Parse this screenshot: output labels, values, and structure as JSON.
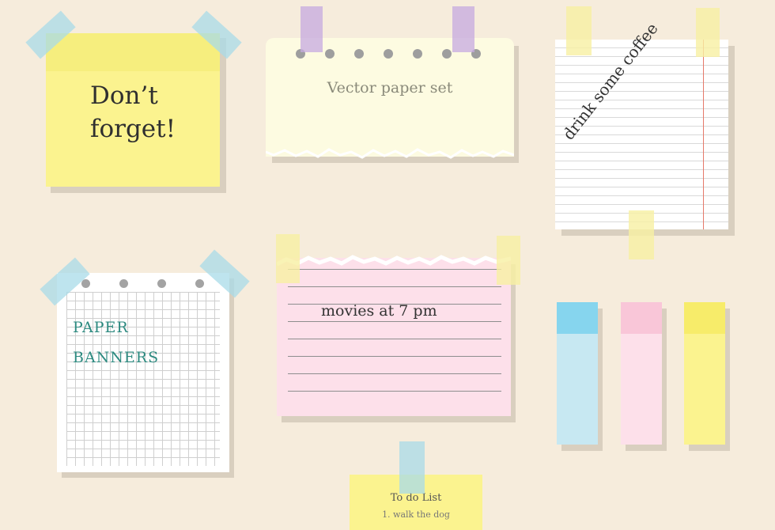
{
  "notes": {
    "dont_forget": {
      "line1": "Don’t",
      "line2": "forget!"
    },
    "vector_set": {
      "text": "Vector paper set"
    },
    "coffee": {
      "text": "drink some coffee"
    },
    "paper_banners": {
      "line1": "PAPER",
      "line2": "BANNERS"
    },
    "movies": {
      "text": "movies at 7 pm"
    },
    "todo": {
      "title": "To do List",
      "item1": "1. walk the dog"
    }
  },
  "colors": {
    "background": "#f6ecdc",
    "yellow": "#fbf38f",
    "blue_tape": "#a8dbe8",
    "purple_tape": "#c5a9e0",
    "pink": "#fde0ea",
    "bookmark_blue": "#c7e8f2",
    "bookmark_pink": "#fde0ea",
    "bookmark_yellow": "#fbf38f"
  }
}
